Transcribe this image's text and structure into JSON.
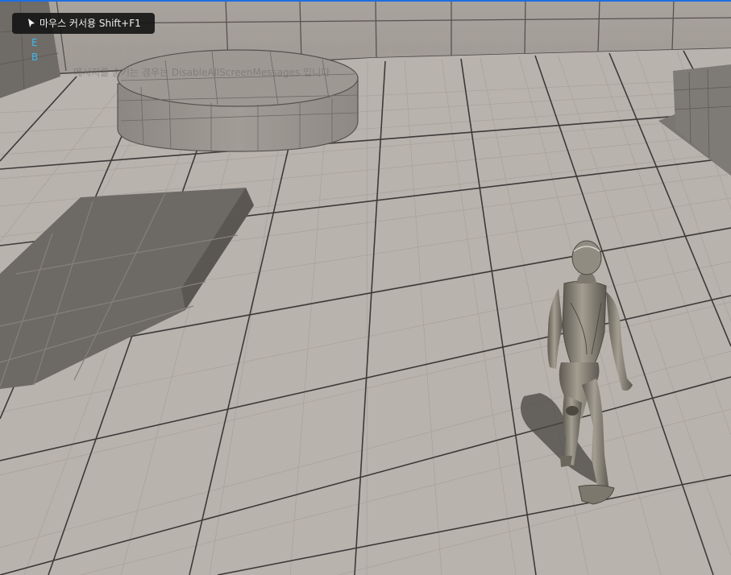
{
  "hud": {
    "cursor_hint": "마우스 커서용 Shift+F1",
    "debug_keys": [
      "E",
      "B"
    ],
    "screen_message": "메시지를 숨기는 경우는 DisableAllScreenMessages 입니다"
  },
  "icons": {
    "cursor": "mouse-pointer-icon"
  },
  "colors": {
    "floor": "#b9b3ad",
    "grid_minor": "#a39d97",
    "grid_major": "#3c3a38",
    "mannequin": "#8a8579",
    "accent_border": "#1f6fe0",
    "debug_text": "#3fb8f0"
  }
}
